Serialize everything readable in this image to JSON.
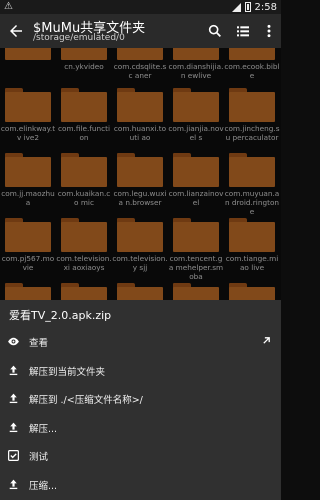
{
  "status": {
    "time": "2:58"
  },
  "toolbar": {
    "title": "$MuMu共享文件夹",
    "path": "/storage/emulated/0"
  },
  "grid": {
    "labels": [
      "",
      "cn.ykvideo",
      "com.cdsqlite.sc aner",
      "com.dianshijia.n ewlive",
      "com.ecook.bible",
      "com.elinkway.tv ive2",
      "com.file.function",
      "com.huanxi.touti ao",
      "com.jianjia.novel s",
      "com.jincheng.su percaculator",
      "com.jj.maozhua",
      "com.kuaikan.co mic",
      "com.legu.wuxia n.browser",
      "com.lianzainovel",
      "com.muyuan.an droid.ringtone",
      "com.pj567.movie",
      "com.television.xi aoxiaoys",
      "com.television.y sjj",
      "com.tencent.ga mehelper.smoba",
      "com.tiange.miao live",
      "",
      "",
      "",
      "",
      ""
    ]
  },
  "sheet": {
    "filename": "爱看TV_2.0.apk.zip",
    "items": [
      {
        "label": "查看"
      },
      {
        "label": "解压到当前文件夹"
      },
      {
        "label": "解压到 ./<压缩文件名称>/"
      },
      {
        "label": "解压..."
      },
      {
        "label": "测试"
      },
      {
        "label": "压缩..."
      }
    ]
  }
}
